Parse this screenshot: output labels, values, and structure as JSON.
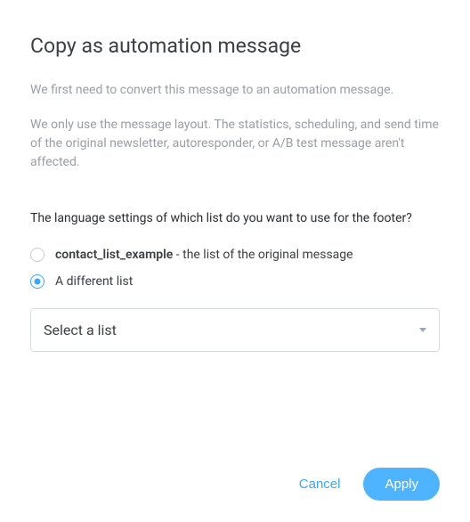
{
  "title": "Copy as automation message",
  "description1": "We first need to convert this message to an automation message.",
  "description2": "We only use the message layout. The statistics, scheduling, and send time of the original newsletter, autoresponder, or A/B test message aren't affected.",
  "question": "The language settings of which list do you want to use for the footer?",
  "options": {
    "original": {
      "bold": "contact_list_example",
      "rest": " - the list of the original message"
    },
    "different": {
      "label": "A different list"
    }
  },
  "select": {
    "placeholder": "Select a list"
  },
  "buttons": {
    "cancel": "Cancel",
    "apply": "Apply"
  }
}
